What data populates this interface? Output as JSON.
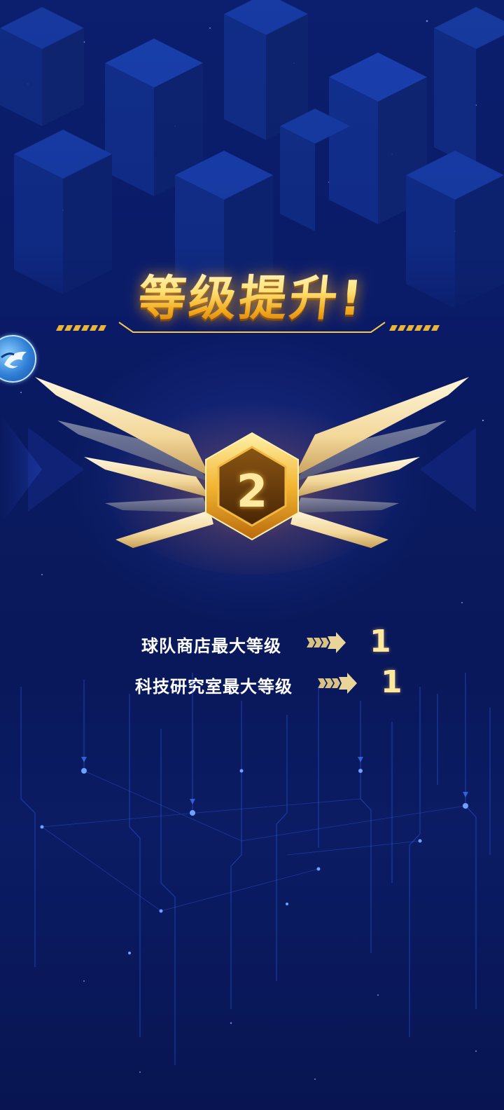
{
  "title": "等级提升!",
  "level_badge": {
    "level": "2",
    "icon": "winged-hexagon-badge-icon"
  },
  "side_avatar": {
    "icon": "dolphin-avatar-icon"
  },
  "unlocks": [
    {
      "label": "球队商店最大等级",
      "value": "1",
      "arrow_icon": "triple-chevron-arrow-icon"
    },
    {
      "label": "科技研究室最大等级",
      "value": "1",
      "arrow_icon": "triple-chevron-arrow-icon"
    }
  ],
  "colors": {
    "background": "#0a1a5e",
    "title_gold": "#ffd766",
    "badge_gold": "#f4b733",
    "value_gold": "#ffe9a0",
    "label_white": "#ffffff"
  }
}
